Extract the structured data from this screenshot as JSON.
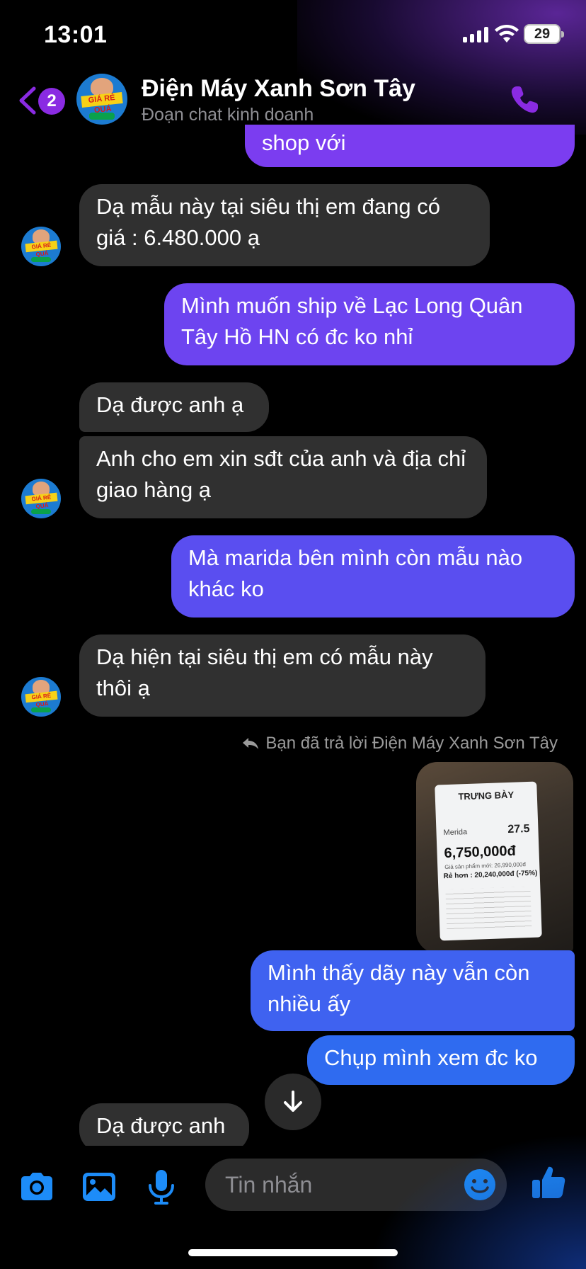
{
  "status": {
    "time": "13:01",
    "battery": "29"
  },
  "header": {
    "back_badge": "2",
    "title": "Điện Máy Xanh Sơn Tây",
    "subtitle": "Đoạn chat kinh doanh",
    "avatar_text": "GIÁ RẺ QUÁ"
  },
  "messages": [
    {
      "from": "me",
      "text": "shop với"
    },
    {
      "from": "them",
      "text": "Dạ mẫu này tại siêu thị em đang có giá : 6.480.000 ạ"
    },
    {
      "from": "me",
      "text": "Mình muốn ship về Lạc Long Quân Tây Hồ HN có đc ko nhỉ"
    },
    {
      "from": "them",
      "text": "Dạ được anh ạ"
    },
    {
      "from": "them",
      "text": "Anh cho em xin sđt của anh và địa chỉ giao hàng ạ"
    },
    {
      "from": "me",
      "text": "Mà marida bên mình còn mẫu nào khác ko"
    },
    {
      "from": "them",
      "text": "Dạ hiện tại siêu thị em có mẫu này thôi ạ"
    },
    {
      "from": "me",
      "text": "Mình thấy dãy này vẫn còn nhiều ấy"
    },
    {
      "from": "me",
      "text": "Chụp mình xem đc ko"
    },
    {
      "from": "them",
      "text": "Dạ được anh"
    }
  ],
  "reply_note": "Bạn đã trả lời Điện Máy Xanh Sơn Tây",
  "photo_tag": {
    "title": "TRƯNG BÀY",
    "name": "Merida",
    "size": "27.5",
    "price": "6,750,000đ",
    "sub": "Giá sản phẩm mới: 26,990,000đ",
    "save": "Rẻ hơn : 20,240,000đ (-75%)"
  },
  "composer": {
    "placeholder": "Tin nhắn"
  },
  "colors": {
    "accent": "#8a2be2",
    "bubble_in": "#303030",
    "out_top": "#7b3df0",
    "out_bottom": "#2f6bf0"
  }
}
